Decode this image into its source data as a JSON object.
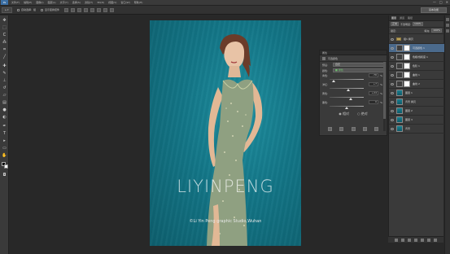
{
  "app": {
    "logo": "Ps",
    "menu": [
      "文件(F)",
      "编辑(E)",
      "图像(I)",
      "图层(L)",
      "文字(Y)",
      "选择(S)",
      "滤镜(T)",
      "3D(D)",
      "视图(V)",
      "窗口(W)",
      "帮助(H)"
    ],
    "window_controls": [
      "—",
      "□",
      "✕"
    ]
  },
  "options_bar": {
    "tool_label": "▸ ▾",
    "auto_select_label": "自动选择:",
    "auto_select_target": "组",
    "show_transform_label": "显示变换控件",
    "workspace": "基本功能"
  },
  "photo": {
    "watermark": "LIYINPENG",
    "credit": "©Li Yin Peng  graphic Studio,Wuhan"
  },
  "properties_panel": {
    "header": "属性",
    "title": "可选颜色",
    "preset_label": "预设:",
    "preset_value": "自定",
    "colors_label": "颜色:",
    "colors_value": "■ 绿色",
    "sliders": [
      {
        "label": "青色:",
        "value": "-76",
        "unit": "%",
        "level": 0.12
      },
      {
        "label": "洋红:",
        "value": "+7",
        "unit": "%",
        "level": 0.54
      },
      {
        "label": "黄色:",
        "value": "+24",
        "unit": "%",
        "level": 0.62
      },
      {
        "label": "黑色:",
        "value": "0",
        "unit": "%",
        "level": 0.5
      }
    ],
    "method_relative": "◉ 相对",
    "method_absolute": "○ 绝对"
  },
  "layers_panel": {
    "tabs": [
      "图层",
      "通道",
      "路径"
    ],
    "blend_mode": "正常",
    "opacity_label": "不透明度:",
    "opacity_value": "100%",
    "lock_label": "锁定:",
    "fill_label": "填充:",
    "fill_value": "100%",
    "layers": [
      {
        "name": "组1 拷贝",
        "kind": "group",
        "selected": false
      },
      {
        "name": "可选颜色 1",
        "kind": "adjustment",
        "selected": true
      },
      {
        "name": "色相/饱和度 1",
        "kind": "adjustment",
        "selected": false
      },
      {
        "name": "色阶 1",
        "kind": "adjustment",
        "selected": false
      },
      {
        "name": "曲线 1",
        "kind": "adjustment",
        "selected": false
      },
      {
        "name": "曲线 2",
        "kind": "adjustment",
        "selected": false
      },
      {
        "name": "图层 1",
        "kind": "pixel",
        "selected": false
      },
      {
        "name": "背景 拷贝",
        "kind": "pixel",
        "selected": false
      },
      {
        "name": "图层 2",
        "kind": "pixel",
        "selected": false
      },
      {
        "name": "图层 3",
        "kind": "pixel",
        "selected": false
      },
      {
        "name": "背景",
        "kind": "pixel",
        "selected": false
      }
    ]
  },
  "colors": {
    "accent_selection": "#4b6a8c",
    "backdrop_teal": "#137687"
  }
}
